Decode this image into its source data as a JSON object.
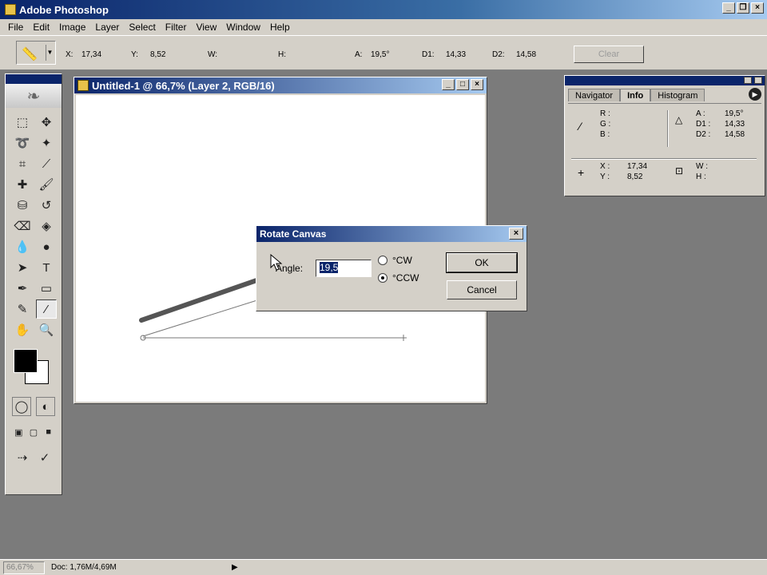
{
  "app": {
    "title": "Adobe Photoshop"
  },
  "window_buttons": [
    "_",
    "❐",
    "×"
  ],
  "menu": [
    "File",
    "Edit",
    "Image",
    "Layer",
    "Select",
    "Filter",
    "View",
    "Window",
    "Help"
  ],
  "options": {
    "x_label": "X:",
    "x_value": "17,34",
    "y_label": "Y:",
    "y_value": "8,52",
    "w_label": "W:",
    "w_value": "",
    "h_label": "H:",
    "h_value": "",
    "a_label": "A:",
    "a_value": "19,5°",
    "d1_label": "D1:",
    "d1_value": "14,33",
    "d2_label": "D2:",
    "d2_value": "14,58",
    "clear_label": "Clear"
  },
  "document": {
    "title": "Untitled-1 @ 66,7% (Layer 2, RGB/16)"
  },
  "info_panel": {
    "tabs": [
      "Navigator",
      "Info",
      "Histogram"
    ],
    "active_tab": "Info",
    "rgb_labels": "R :\nG :\nB :",
    "angle_labels": "A :\nD1 :\nD2 :",
    "angle_values": "19,5°\n14,33\n14,58",
    "xy_labels": "X :\nY :",
    "xy_values": "17,34\n8,52",
    "wh_labels": "W :\nH :"
  },
  "dialog": {
    "title": "Rotate Canvas",
    "angle_label": "Angle:",
    "angle_value": "19,5",
    "cw_label": "°CW",
    "ccw_label": "°CCW",
    "selected": "CCW",
    "ok_label": "OK",
    "cancel_label": "Cancel"
  },
  "status": {
    "zoom": "66,67%",
    "doc": "Doc: 1,76M/4,69M"
  },
  "icons": {
    "ruler": "📏",
    "marquee": "⬚",
    "move": "✥",
    "lasso": "➰",
    "wand": "✦",
    "crop": "⌗",
    "slice": "⟋",
    "healing": "✚",
    "brush": "🖌",
    "stamp": "⛁",
    "history": "↺",
    "eraser": "⌫",
    "bucket": "◈",
    "blur": "💧",
    "dodge": "●",
    "path_select": "➤",
    "type": "T",
    "pen": "✒",
    "shape": "▭",
    "notes": "✎",
    "eyedropper": "⁄",
    "hand": "✋",
    "zoom": "🔍"
  },
  "colors": {
    "accent": "#0a246a",
    "foreground": "#000000",
    "background": "#ffffff"
  }
}
